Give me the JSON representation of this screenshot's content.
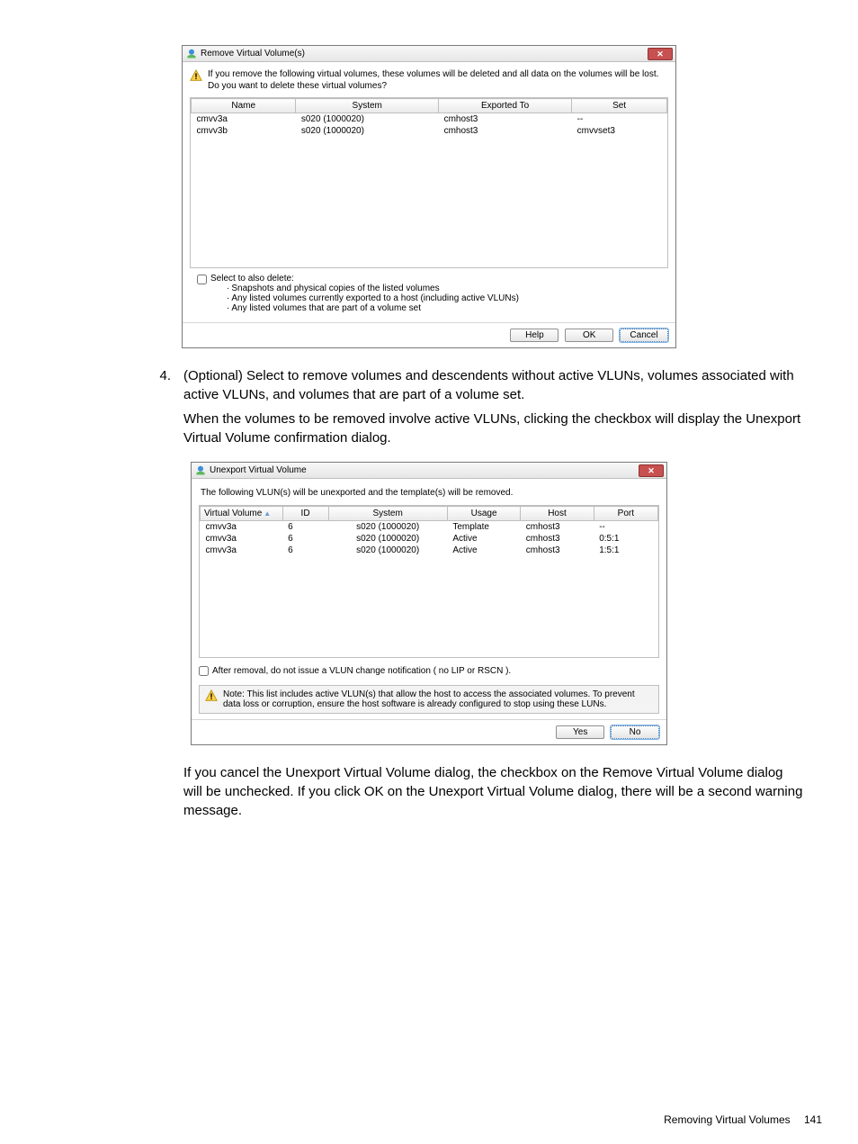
{
  "dialog1": {
    "title": "Remove Virtual Volume(s)",
    "warning_line1": "If you remove the following virtual volumes, these volumes will be deleted and all data on the volumes will be lost.",
    "warning_line2": "Do you want to delete these virtual volumes?",
    "headers": {
      "name": "Name",
      "system": "System",
      "exported": "Exported To",
      "set": "Set"
    },
    "rows": [
      {
        "name": "cmvv3a",
        "system": "s020 (1000020)",
        "exported": "cmhost3",
        "set": "--"
      },
      {
        "name": "cmvv3b",
        "system": "s020 (1000020)",
        "exported": "cmhost3",
        "set": "cmvvset3"
      }
    ],
    "also_delete_label": "Select to also delete:",
    "bullet1": "Snapshots and physical copies of the listed volumes",
    "bullet2": "Any listed volumes currently exported to a host (including active VLUNs)",
    "bullet3": "Any listed volumes that are part of a volume set",
    "btn_help": "Help",
    "btn_ok": "OK",
    "btn_cancel": "Cancel"
  },
  "step4": {
    "number": "4.",
    "text": "(Optional) Select to remove volumes and descendents without active VLUNs, volumes associated with active VLUNs, and volumes that are part of a volume set.",
    "para2": "When the volumes to be removed involve active VLUNs, clicking the checkbox will display the Unexport Virtual Volume confirmation dialog."
  },
  "dialog2": {
    "title": "Unexport Virtual Volume",
    "intro": "The following VLUN(s) will be unexported and the template(s) will be removed.",
    "headers": {
      "vv": "Virtual Volume",
      "id": "ID",
      "system": "System",
      "usage": "Usage",
      "host": "Host",
      "port": "Port"
    },
    "rows": [
      {
        "vv": "cmvv3a",
        "id": "6",
        "system": "s020 (1000020)",
        "usage": "Template",
        "host": "cmhost3",
        "port": "--"
      },
      {
        "vv": "cmvv3a",
        "id": "6",
        "system": "s020 (1000020)",
        "usage": "Active",
        "host": "cmhost3",
        "port": "0:5:1"
      },
      {
        "vv": "cmvv3a",
        "id": "6",
        "system": "s020 (1000020)",
        "usage": "Active",
        "host": "cmhost3",
        "port": "1:5:1"
      }
    ],
    "cb_after": "After removal, do not issue a VLUN change notification ( no LIP or RSCN ).",
    "note": "Note: This list includes active VLUN(s) that allow the host to access the associated volumes. To prevent data loss or corruption, ensure the host software is already configured to stop using these LUNs.",
    "btn_yes": "Yes",
    "btn_no": "No"
  },
  "para_after": "If you cancel the Unexport Virtual Volume dialog, the checkbox on the Remove Virtual Volume dialog will be unchecked. If you click OK on the Unexport Virtual Volume dialog, there will be a second warning message.",
  "footer": {
    "section": "Removing Virtual Volumes",
    "page": "141"
  }
}
